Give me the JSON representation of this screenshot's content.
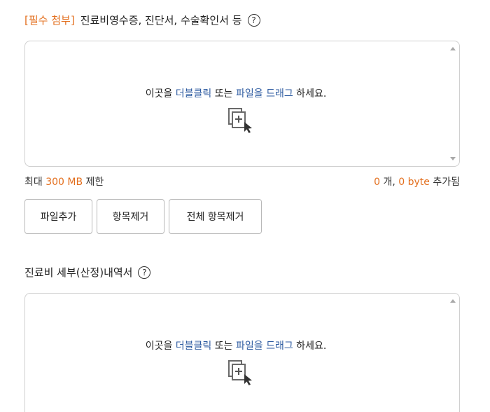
{
  "section1": {
    "required_tag": "[필수 첨부]",
    "title": "진료비영수증, 진단서, 수술확인서 등",
    "help_glyph": "?",
    "dropzone": {
      "prefix": "이곳을 ",
      "highlight1": "더블클릭",
      "middle": " 또는 ",
      "highlight2": "파일을 드래그",
      "suffix": " 하세요."
    },
    "limit": {
      "prefix": "최대 ",
      "value": "300 MB",
      "suffix": " 제한"
    },
    "count": {
      "files": "0",
      "files_unit": " 개, ",
      "bytes": "0 byte",
      "suffix": " 추가됨"
    },
    "buttons": {
      "add": "파일추가",
      "remove": "항목제거",
      "remove_all": "전체 항목제거"
    }
  },
  "section2": {
    "title": "진료비 세부(산정)내역서",
    "help_glyph": "?",
    "dropzone": {
      "prefix": "이곳을 ",
      "highlight1": "더블클릭",
      "middle": " 또는 ",
      "highlight2": "파일을 드래그",
      "suffix": " 하세요."
    }
  },
  "colors": {
    "accent_orange": "#e36f1e",
    "link_blue": "#2c5aa0"
  }
}
